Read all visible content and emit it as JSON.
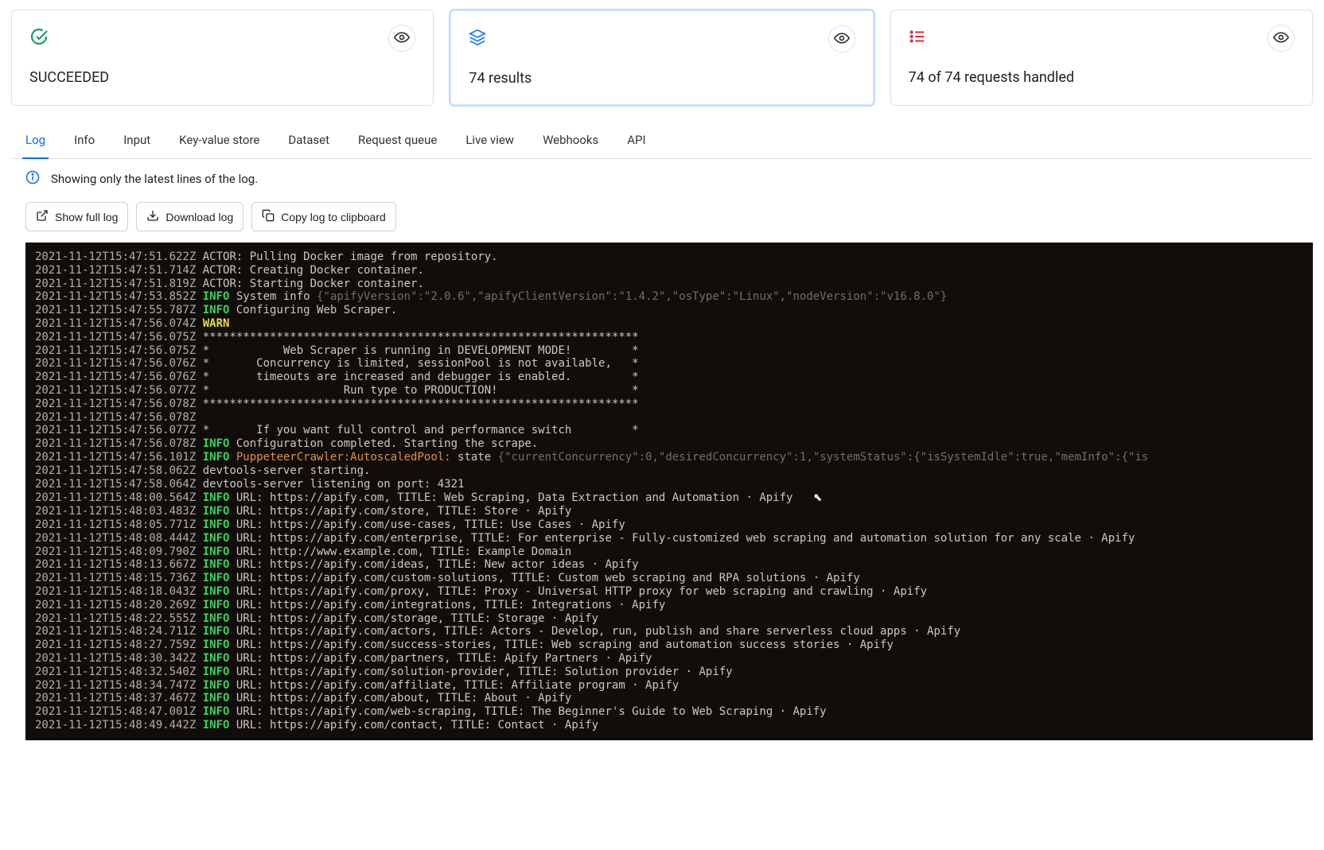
{
  "cards": {
    "status": {
      "label": "SUCCEEDED"
    },
    "results": {
      "label": "74 results"
    },
    "requests": {
      "label": "74 of 74 requests handled"
    }
  },
  "tabs": [
    "Log",
    "Info",
    "Input",
    "Key-value store",
    "Dataset",
    "Request queue",
    "Live view",
    "Webhooks",
    "API"
  ],
  "notice": "Showing only the latest lines of the log.",
  "buttons": {
    "full": "Show full log",
    "download": "Download log",
    "copy": "Copy log to clipboard"
  },
  "log": [
    {
      "ts": "2021-11-12T15:47:51.622Z",
      "lvl": "",
      "txt": "ACTOR: Pulling Docker image from repository."
    },
    {
      "ts": "2021-11-12T15:47:51.714Z",
      "lvl": "",
      "txt": "ACTOR: Creating Docker container."
    },
    {
      "ts": "2021-11-12T15:47:51.819Z",
      "lvl": "",
      "txt": "ACTOR: Starting Docker container."
    },
    {
      "ts": "2021-11-12T15:47:53.852Z",
      "lvl": "INFO",
      "txt": " System info ",
      "gray": "{\"apifyVersion\":\"2.0.6\",\"apifyClientVersion\":\"1.4.2\",\"osType\":\"Linux\",\"nodeVersion\":\"v16.8.0\"}"
    },
    {
      "ts": "2021-11-12T15:47:55.787Z",
      "lvl": "INFO",
      "txt": " Configuring Web Scraper."
    },
    {
      "ts": "2021-11-12T15:47:56.074Z",
      "lvl": "WARN",
      "txt": ""
    },
    {
      "ts": "2021-11-12T15:47:56.075Z",
      "lvl": "",
      "txt": "*****************************************************************    "
    },
    {
      "ts": "2021-11-12T15:47:56.075Z",
      "lvl": "",
      "txt": "*           Web Scraper is running in DEVELOPMENT MODE!         *    "
    },
    {
      "ts": "2021-11-12T15:47:56.076Z",
      "lvl": "",
      "txt": "*       Concurrency is limited, sessionPool is not available,   *    "
    },
    {
      "ts": "2021-11-12T15:47:56.076Z",
      "lvl": "",
      "txt": "*       timeouts are increased and debugger is enabled.         *    "
    },
    {
      "ts": "2021-11-12T15:47:56.077Z",
      "lvl": "",
      "txt": "*                    Run type to PRODUCTION!                    *    "
    },
    {
      "ts": "2021-11-12T15:47:56.078Z",
      "lvl": "",
      "txt": "*****************************************************************    "
    },
    {
      "ts": "2021-11-12T15:47:56.078Z",
      "lvl": "",
      "txt": ""
    },
    {
      "ts": "2021-11-12T15:47:56.077Z",
      "lvl": "",
      "txt": "*       If you want full control and performance switch         *    "
    },
    {
      "ts": "2021-11-12T15:47:56.078Z",
      "lvl": "INFO",
      "txt": " Configuration completed. Starting the scrape."
    },
    {
      "ts": "2021-11-12T15:47:56.101Z",
      "lvl": "INFO",
      "orange": " PuppeteerCrawler:AutoscaledPool:",
      "txt": " state ",
      "gray": "{\"currentConcurrency\":0,\"desiredConcurrency\":1,\"systemStatus\":{\"isSystemIdle\":true,\"memInfo\":{\"is"
    },
    {
      "ts": "2021-11-12T15:47:58.062Z",
      "lvl": "",
      "txt": "devtools-server starting."
    },
    {
      "ts": "2021-11-12T15:47:58.064Z",
      "lvl": "",
      "txt": "devtools-server listening on port: 4321"
    },
    {
      "ts": "2021-11-12T15:48:00.564Z",
      "lvl": "INFO",
      "txt": " URL: https://apify.com, TITLE: Web Scraping, Data Extraction and Automation · Apify",
      "cursor": true
    },
    {
      "ts": "2021-11-12T15:48:03.483Z",
      "lvl": "INFO",
      "txt": " URL: https://apify.com/store, TITLE: Store · Apify"
    },
    {
      "ts": "2021-11-12T15:48:05.771Z",
      "lvl": "INFO",
      "txt": " URL: https://apify.com/use-cases, TITLE: Use Cases · Apify"
    },
    {
      "ts": "2021-11-12T15:48:08.444Z",
      "lvl": "INFO",
      "txt": " URL: https://apify.com/enterprise, TITLE: For enterprise - Fully-customized web scraping and automation solution for any scale · Apify"
    },
    {
      "ts": "2021-11-12T15:48:09.790Z",
      "lvl": "INFO",
      "txt": " URL: http://www.example.com, TITLE: Example Domain"
    },
    {
      "ts": "2021-11-12T15:48:13.667Z",
      "lvl": "INFO",
      "txt": " URL: https://apify.com/ideas, TITLE: New actor ideas · Apify"
    },
    {
      "ts": "2021-11-12T15:48:15.736Z",
      "lvl": "INFO",
      "txt": " URL: https://apify.com/custom-solutions, TITLE: Custom web scraping and RPA solutions · Apify"
    },
    {
      "ts": "2021-11-12T15:48:18.043Z",
      "lvl": "INFO",
      "txt": " URL: https://apify.com/proxy, TITLE: Proxy - Universal HTTP proxy for web scraping and crawling · Apify"
    },
    {
      "ts": "2021-11-12T15:48:20.269Z",
      "lvl": "INFO",
      "txt": " URL: https://apify.com/integrations, TITLE: Integrations · Apify"
    },
    {
      "ts": "2021-11-12T15:48:22.555Z",
      "lvl": "INFO",
      "txt": " URL: https://apify.com/storage, TITLE: Storage · Apify"
    },
    {
      "ts": "2021-11-12T15:48:24.711Z",
      "lvl": "INFO",
      "txt": " URL: https://apify.com/actors, TITLE: Actors - Develop, run, publish and share serverless cloud apps · Apify"
    },
    {
      "ts": "2021-11-12T15:48:27.759Z",
      "lvl": "INFO",
      "txt": " URL: https://apify.com/success-stories, TITLE: Web scraping and automation success stories · Apify"
    },
    {
      "ts": "2021-11-12T15:48:30.342Z",
      "lvl": "INFO",
      "txt": " URL: https://apify.com/partners, TITLE: Apify Partners · Apify"
    },
    {
      "ts": "2021-11-12T15:48:32.540Z",
      "lvl": "INFO",
      "txt": " URL: https://apify.com/solution-provider, TITLE: Solution provider · Apify"
    },
    {
      "ts": "2021-11-12T15:48:34.747Z",
      "lvl": "INFO",
      "txt": " URL: https://apify.com/affiliate, TITLE: Affiliate program · Apify"
    },
    {
      "ts": "2021-11-12T15:48:37.467Z",
      "lvl": "INFO",
      "txt": " URL: https://apify.com/about, TITLE: About · Apify"
    },
    {
      "ts": "2021-11-12T15:48:47.001Z",
      "lvl": "INFO",
      "txt": " URL: https://apify.com/web-scraping, TITLE: The Beginner's Guide to Web Scraping · Apify"
    },
    {
      "ts": "2021-11-12T15:48:49.442Z",
      "lvl": "INFO",
      "txt": " URL: https://apify.com/contact, TITLE: Contact · Apify"
    }
  ]
}
